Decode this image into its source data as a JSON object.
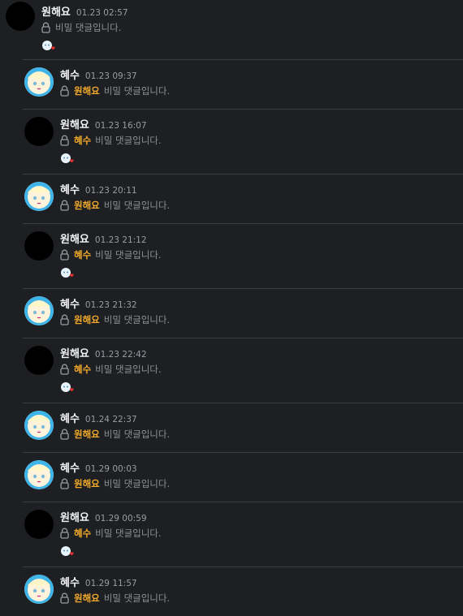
{
  "secret_text": "비밀 댓글입니다.",
  "comments": [
    {
      "author": "원해요",
      "time": "01.23 02:57",
      "mention": "",
      "avatar": "black",
      "react": true
    },
    {
      "author": "혜수",
      "time": "01.23 09:37",
      "mention": "원해요",
      "avatar": "char",
      "react": false
    },
    {
      "author": "원해요",
      "time": "01.23 16:07",
      "mention": "혜수",
      "avatar": "black",
      "react": true
    },
    {
      "author": "혜수",
      "time": "01.23 20:11",
      "mention": "원해요",
      "avatar": "char",
      "react": false
    },
    {
      "author": "원해요",
      "time": "01.23 21:12",
      "mention": "혜수",
      "avatar": "black",
      "react": true
    },
    {
      "author": "혜수",
      "time": "01.23 21:32",
      "mention": "원해요",
      "avatar": "char",
      "react": false
    },
    {
      "author": "원해요",
      "time": "01.23 22:42",
      "mention": "혜수",
      "avatar": "black",
      "react": true
    },
    {
      "author": "혜수",
      "time": "01.24 22:37",
      "mention": "원해요",
      "avatar": "char",
      "react": false
    },
    {
      "author": "혜수",
      "time": "01.29 00:03",
      "mention": "원해요",
      "avatar": "char",
      "react": false
    },
    {
      "author": "원해요",
      "time": "01.29 00:59",
      "mention": "혜수",
      "avatar": "black",
      "react": true
    },
    {
      "author": "혜수",
      "time": "01.29 11:57",
      "mention": "원해요",
      "avatar": "char",
      "react": false
    }
  ],
  "colors": {
    "background": "#1e1f22",
    "mention": "#f0a92a",
    "divider": "#3a3c41"
  }
}
